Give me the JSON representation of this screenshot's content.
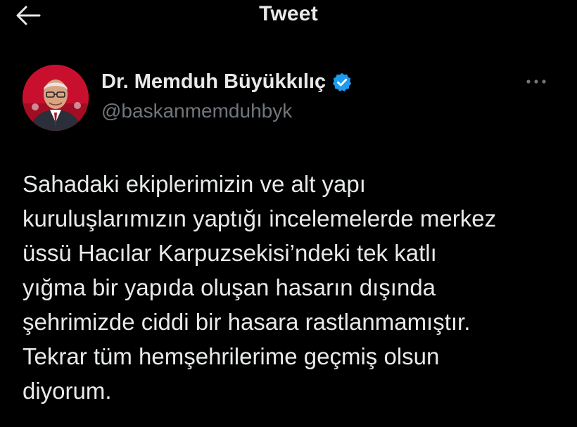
{
  "header": {
    "title": "Tweet",
    "back_icon": "arrow-left-icon"
  },
  "author": {
    "display_name": "Dr. Memduh Büyükkılıç",
    "handle": "@baskanmemduhbyk",
    "verified": true,
    "verified_icon": "verified-badge-icon",
    "more_icon": "more-horizontal-icon"
  },
  "tweet": {
    "text": "Sahadaki ekiplerimizin ve alt yapı\nkuruluşlarımızın yaptığı incelemelerde merkez\nüssü Hacılar Karpuzsekisi’ndeki tek katlı\nyığma bir yapıda oluşan hasarın dışında\nşehrimizde ciddi bir hasara rastlanmamıştır.\nTekrar tüm hemşehrilerime geçmiş olsun\ndiyorum."
  },
  "colors": {
    "background": "#000000",
    "text_primary": "#e7e9ea",
    "text_secondary": "#71767b",
    "verified": "#1d9bf0"
  }
}
